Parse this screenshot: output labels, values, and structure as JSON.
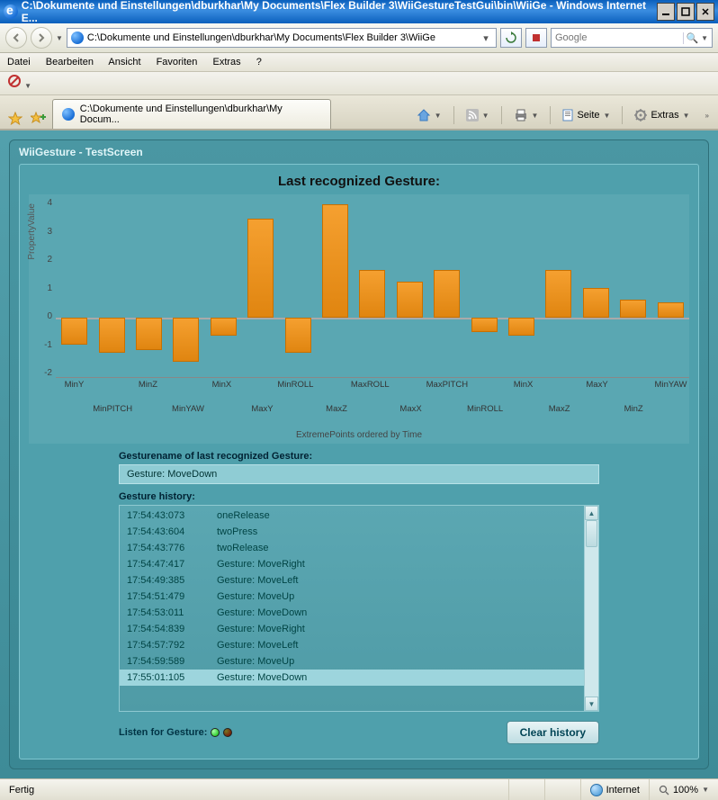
{
  "window": {
    "title": "C:\\Dokumente und Einstellungen\\dburkhar\\My Documents\\Flex Builder 3\\WiiGestureTestGui\\bin\\WiiGe - Windows Internet E..."
  },
  "address": {
    "path": "C:\\Dokumente und Einstellungen\\dburkhar\\My Documents\\Flex Builder 3\\WiiGe"
  },
  "search": {
    "placeholder": "Google"
  },
  "menu": {
    "file": "Datei",
    "edit": "Bearbeiten",
    "view": "Ansicht",
    "favorites": "Favoriten",
    "extras": "Extras",
    "help": "?"
  },
  "tab": {
    "label": "C:\\Dokumente und Einstellungen\\dburkhar\\My Docum..."
  },
  "toolbar": {
    "page": "Seite",
    "extras": "Extras"
  },
  "panel": {
    "title": "WiiGesture - TestScreen"
  },
  "chart_data": {
    "type": "bar",
    "title": "Last recognized Gesture:",
    "ylabel": "PropertyValue",
    "xlabel": "ExtremePoints ordered by Time",
    "ylim": [
      -2,
      4
    ],
    "categories": [
      "MinY",
      "MinPITCH",
      "MinZ",
      "MinYAW",
      "MinX",
      "MaxY",
      "MinROLL",
      "MaxZ",
      "MaxROLL",
      "MaxX",
      "MaxPITCH",
      "MinROLL",
      "MinX",
      "MaxZ",
      "MaxY",
      "MinZ",
      "MinYAW"
    ],
    "values": [
      -0.9,
      -1.2,
      -1.1,
      -1.5,
      -0.6,
      3.3,
      -1.2,
      3.8,
      1.6,
      1.2,
      1.6,
      -0.5,
      -0.6,
      1.6,
      1.0,
      0.6,
      0.5
    ]
  },
  "gesture": {
    "section_label": "Gesturename of last recognized Gesture:",
    "name": "Gesture: MoveDown"
  },
  "history": {
    "label": "Gesture history:",
    "rows": [
      {
        "ts": "17:54:43:073",
        "ev": "oneRelease"
      },
      {
        "ts": "17:54:43:604",
        "ev": "twoPress"
      },
      {
        "ts": "17:54:43:776",
        "ev": "twoRelease"
      },
      {
        "ts": "17:54:47:417",
        "ev": "Gesture: MoveRight"
      },
      {
        "ts": "17:54:49:385",
        "ev": "Gesture: MoveLeft"
      },
      {
        "ts": "17:54:51:479",
        "ev": "Gesture: MoveUp"
      },
      {
        "ts": "17:54:53:011",
        "ev": "Gesture: MoveDown"
      },
      {
        "ts": "17:54:54:839",
        "ev": "Gesture: MoveRight"
      },
      {
        "ts": "17:54:57:792",
        "ev": "Gesture: MoveLeft"
      },
      {
        "ts": "17:54:59:589",
        "ev": "Gesture: MoveUp"
      },
      {
        "ts": "17:55:01:105",
        "ev": "Gesture: MoveDown"
      }
    ]
  },
  "listen": {
    "label": "Listen for Gesture:"
  },
  "clear": {
    "label": "Clear history"
  },
  "status": {
    "done": "Fertig",
    "zone": "Internet",
    "zoom": "100%"
  }
}
